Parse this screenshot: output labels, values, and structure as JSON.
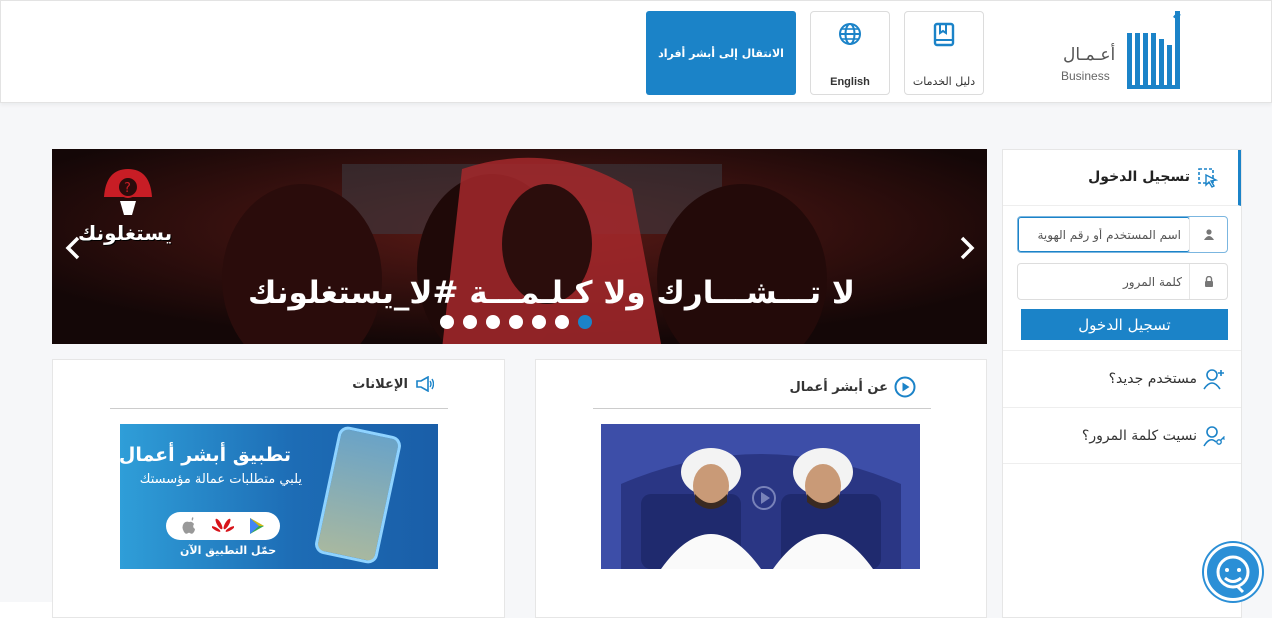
{
  "header": {
    "logo_ar": "أعـمـال",
    "logo_en": "Business",
    "guide_label": "دليل الخدمات",
    "guide_icon": "book-icon",
    "lang_label": "English",
    "lang_icon": "globe-icon",
    "switch_label": "الانتقال إلى أبشر أفراد",
    "brand_color": "#1b83c8"
  },
  "banner": {
    "headline": "لا تـــشـــارك ولا كـلـمـــة #لا_يستغلونك",
    "campaign": "يستغلونك",
    "slides": 7,
    "active_slide": 7
  },
  "announcements": {
    "title": "الإعلانات",
    "icon": "megaphone-icon",
    "ad_title": "تطبيق أبشر أعمال",
    "ad_subtitle": "يلبي متطلبات عمالة مؤسستك",
    "ad_download": "حمّل التطبيق الآن"
  },
  "about": {
    "title": "عن أبشر أعمال",
    "icon": "play-circle-icon"
  },
  "login": {
    "title": "تسجيل الدخول",
    "username_placeholder": "اسم المستخدم أو رقم الهوية",
    "password_placeholder": "كلمة المرور",
    "submit_label": "تسجيل الدخول",
    "new_user": "مستخدم جديد؟",
    "forgot_password": "نسيت كلمة المرور؟"
  }
}
